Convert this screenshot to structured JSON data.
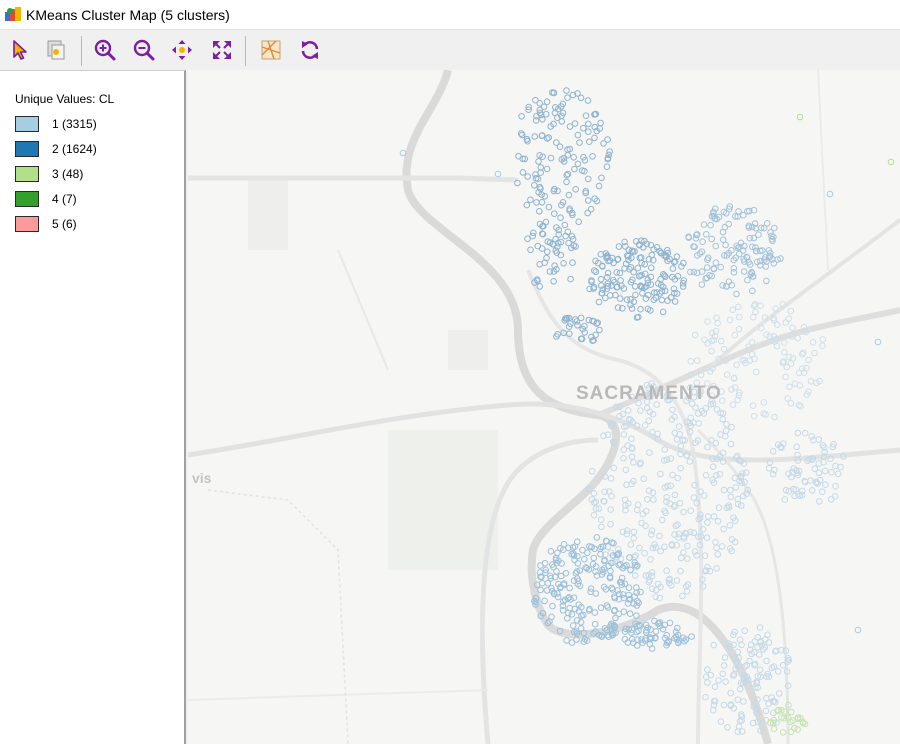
{
  "window": {
    "title": "KMeans Cluster Map (5 clusters)"
  },
  "toolbar": {
    "buttons": [
      {
        "name": "select-tool",
        "icon": "pointer-arrow-icon"
      },
      {
        "name": "selection-copy",
        "icon": "select-copy-icon"
      },
      {
        "name": "zoom-in",
        "icon": "zoom-in-icon"
      },
      {
        "name": "zoom-out",
        "icon": "zoom-out-icon"
      },
      {
        "name": "pan",
        "icon": "pan-arrows-icon"
      },
      {
        "name": "full-extent",
        "icon": "full-extent-icon"
      },
      {
        "name": "basemap",
        "icon": "basemap-icon"
      },
      {
        "name": "refresh",
        "icon": "refresh-icon"
      }
    ]
  },
  "legend": {
    "title": "Unique Values: CL",
    "items": [
      {
        "label": "1 (3315)",
        "color": "#a6cee3"
      },
      {
        "label": "2 (1624)",
        "color": "#1f78b4"
      },
      {
        "label": "3 (48)",
        "color": "#b2df8a"
      },
      {
        "label": "4 (7)",
        "color": "#33a02c"
      },
      {
        "label": "5 (6)",
        "color": "#fb9a99"
      }
    ]
  },
  "map": {
    "city_label": "SACRAMENTO",
    "place_label": "vis",
    "accent_purple": "#7a1fa2"
  }
}
